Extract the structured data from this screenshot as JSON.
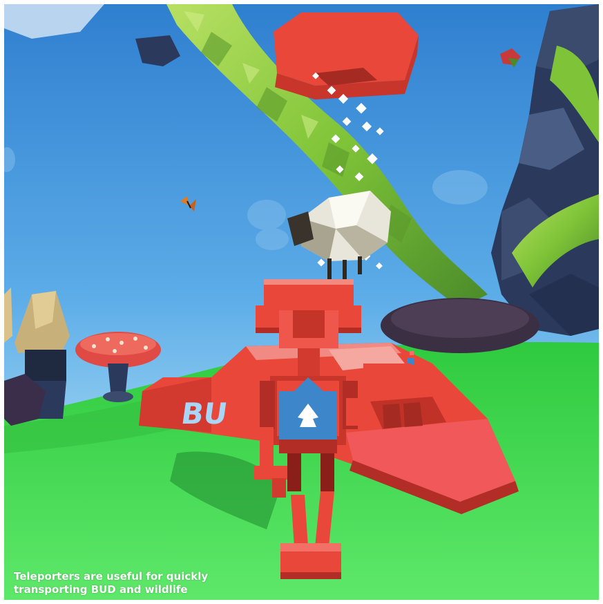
{
  "scene": {
    "sign_text": "BU",
    "caption": {
      "line1": "Teleporters are useful for quickly",
      "line2": "transporting BUD and wildlife"
    }
  },
  "colors": {
    "sky": "#3e90d6",
    "grass": "#3ed34a",
    "robot_red": "#e9473a",
    "robot_blue": "#3d86c9",
    "vine_green": "#8fcf3a",
    "rock_navy": "#2b3a5c"
  }
}
